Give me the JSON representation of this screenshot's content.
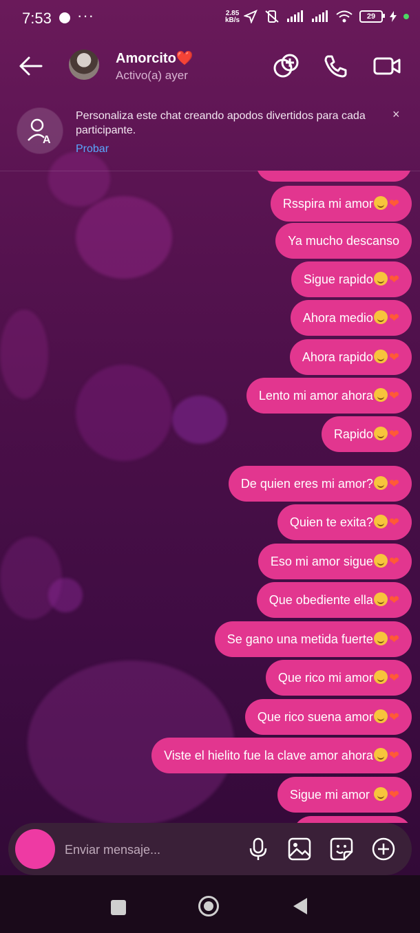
{
  "status_bar": {
    "time": "7:53",
    "more": "···",
    "speed_value": "2.85",
    "speed_unit": "kB/s",
    "battery": "29"
  },
  "header": {
    "contact_name": "Amorcito",
    "contact_heart": "❤️",
    "contact_status": "Activo(a) ayer"
  },
  "banner": {
    "text": "Personaliza este chat creando apodos divertidos para cada participante.",
    "link": "Probar",
    "close": "×"
  },
  "messages": [
    {
      "text": "Rsspira mi amor",
      "smile": true,
      "heart": true
    },
    {
      "text": "Ya mucho descanso",
      "smile": false,
      "heart": false
    },
    {
      "text": "Sigue rapido",
      "smile": true,
      "heart": true
    },
    {
      "text": "Ahora medio",
      "smile": true,
      "heart": true
    },
    {
      "text": "Ahora rapido",
      "smile": true,
      "heart": true
    },
    {
      "text": "Lento mi amor ahora",
      "smile": true,
      "heart": true
    },
    {
      "text": "Rapido",
      "smile": true,
      "heart": true
    },
    {
      "text": "De quien eres mi amor?",
      "smile": true,
      "heart": true
    },
    {
      "text": "Quien te exita?",
      "smile": true,
      "heart": true
    },
    {
      "text": "Eso mi amor sigue",
      "smile": true,
      "heart": true
    },
    {
      "text": "Que obediente ella",
      "smile": true,
      "heart": true
    },
    {
      "text": "Se gano una metida fuerte",
      "smile": true,
      "heart": true
    },
    {
      "text": "Que rico mi amor",
      "smile": true,
      "heart": true
    },
    {
      "text": "Que rico suena amor",
      "smile": true,
      "heart": true
    },
    {
      "text": "Viste el hielito fue la clave amor ahora",
      "smile": true,
      "heart": true
    },
    {
      "text": "Sigue mi amor ",
      "smile": true,
      "heart": true
    }
  ],
  "composer": {
    "placeholder": "Enviar mensaje..."
  },
  "colors": {
    "bubble": "#e2368f",
    "link": "#5aa8ff",
    "camera": "#ee3aa3"
  }
}
